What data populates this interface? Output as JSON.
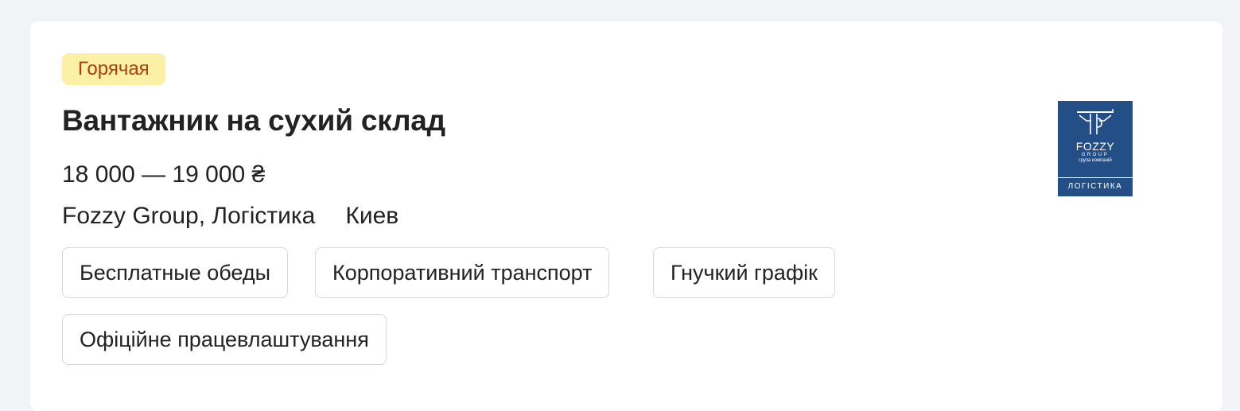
{
  "badge": "Горячая",
  "vacancy": {
    "title": "Вантажник на сухий склад",
    "salary": "18 000 — 19 000 ₴",
    "company": "Fozzy Group, Логістика",
    "city": "Киев"
  },
  "tags": [
    "Бесплатные обеды",
    "Корпоративний транспорт",
    "Гнучкий графік",
    "Офіційне працевлаштування"
  ],
  "logo": {
    "brand": "FOZZY",
    "group": "GROUP",
    "sub": "група компаній",
    "unit": "ЛОГІСТИКА",
    "color": "#244f86"
  },
  "colors": {
    "badge_bg": "#fbf0a6",
    "badge_text": "#a8420e",
    "page_bg": "#f2f3f7"
  }
}
